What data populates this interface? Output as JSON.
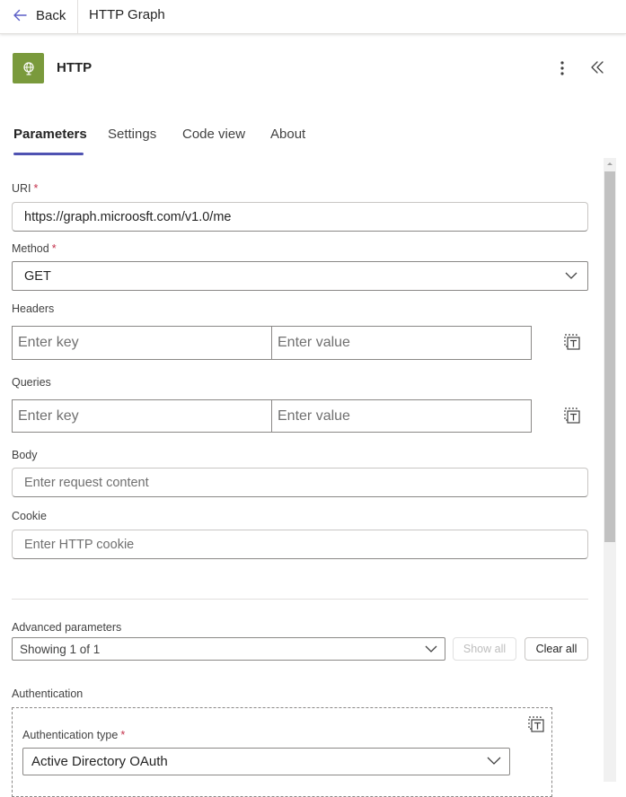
{
  "topbar": {
    "back_label": "Back",
    "breadcrumb": "HTTP Graph"
  },
  "header": {
    "title": "HTTP",
    "icon_color": "#7a9a3c"
  },
  "tabs": [
    {
      "label": "Parameters",
      "active": true
    },
    {
      "label": "Settings",
      "active": false
    },
    {
      "label": "Code view",
      "active": false
    },
    {
      "label": "About",
      "active": false
    }
  ],
  "accent_color": "#4f52b2",
  "form": {
    "uri": {
      "label": "URI",
      "required_mark": "*",
      "value": "https://graph.microosft.com/v1.0/me"
    },
    "method": {
      "label": "Method",
      "required_mark": "*",
      "value": "GET"
    },
    "headers": {
      "label": "Headers",
      "key_placeholder": "Enter key",
      "value_placeholder": "Enter value"
    },
    "queries": {
      "label": "Queries",
      "key_placeholder": "Enter key",
      "value_placeholder": "Enter value"
    },
    "body": {
      "label": "Body",
      "placeholder": "Enter request content"
    },
    "cookie": {
      "label": "Cookie",
      "placeholder": "Enter HTTP cookie"
    }
  },
  "advanced": {
    "label": "Advanced parameters",
    "selected": "Showing 1 of 1",
    "show_all": "Show all",
    "clear_all": "Clear all"
  },
  "authentication": {
    "label": "Authentication",
    "type_label": "Authentication type",
    "required_mark": "*",
    "type_value": "Active Directory OAuth"
  }
}
